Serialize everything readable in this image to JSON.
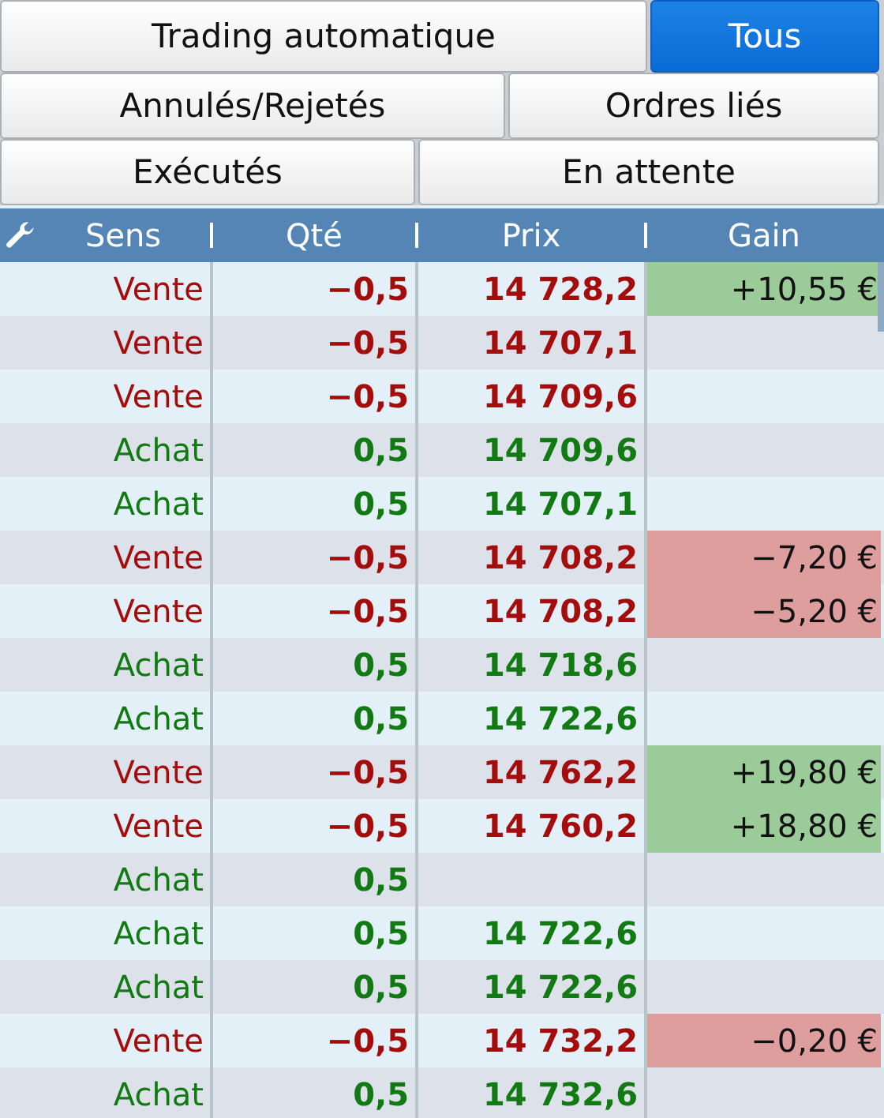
{
  "tab_rows": [
    [
      {
        "label": "Trading automatique",
        "selected": false
      },
      {
        "label": "Tous",
        "selected": true
      }
    ],
    [
      {
        "label": "Annulés/Rejetés",
        "selected": false
      },
      {
        "label": "Ordres liés",
        "selected": false
      }
    ],
    [
      {
        "label": "Exécutés",
        "selected": false
      },
      {
        "label": "En attente",
        "selected": false
      }
    ]
  ],
  "table": {
    "columns": [
      "Sens",
      "Qté",
      "Prix",
      "Gain"
    ],
    "rows": [
      {
        "kind": "sell",
        "sens": "Vente",
        "qty": "−0,5",
        "price": "14 728,2",
        "gain": {
          "text": "+10,55 €",
          "kind": "profit"
        }
      },
      {
        "kind": "sell",
        "sens": "Vente",
        "qty": "−0,5",
        "price": "14 707,1"
      },
      {
        "kind": "sell",
        "sens": "Vente",
        "qty": "−0,5",
        "price": "14 709,6"
      },
      {
        "kind": "buy",
        "sens": "Achat",
        "qty": "0,5",
        "price": "14 709,6"
      },
      {
        "kind": "buy",
        "sens": "Achat",
        "qty": "0,5",
        "price": "14 707,1"
      },
      {
        "kind": "sell",
        "sens": "Vente",
        "qty": "−0,5",
        "price": "14 708,2",
        "gain": {
          "text": "−7,20 €",
          "kind": "loss"
        }
      },
      {
        "kind": "sell",
        "sens": "Vente",
        "qty": "−0,5",
        "price": "14 708,2",
        "gain": {
          "text": "−5,20 €",
          "kind": "loss"
        }
      },
      {
        "kind": "buy",
        "sens": "Achat",
        "qty": "0,5",
        "price": "14 718,6"
      },
      {
        "kind": "buy",
        "sens": "Achat",
        "qty": "0,5",
        "price": "14 722,6"
      },
      {
        "kind": "sell",
        "sens": "Vente",
        "qty": "−0,5",
        "price": "14 762,2",
        "gain": {
          "text": "+19,80 €",
          "kind": "profit"
        }
      },
      {
        "kind": "sell",
        "sens": "Vente",
        "qty": "−0,5",
        "price": "14 760,2",
        "gain": {
          "text": "+18,80 €",
          "kind": "profit"
        }
      },
      {
        "kind": "buy",
        "sens": "Achat",
        "qty": "0,5"
      },
      {
        "kind": "buy",
        "sens": "Achat",
        "qty": "0,5",
        "price": "14 722,6"
      },
      {
        "kind": "buy",
        "sens": "Achat",
        "qty": "0,5",
        "price": "14 722,6"
      },
      {
        "kind": "sell",
        "sens": "Vente",
        "qty": "−0,5",
        "price": "14 732,2",
        "gain": {
          "text": "−0,20 €",
          "kind": "loss"
        }
      },
      {
        "kind": "buy",
        "sens": "Achat",
        "qty": "0,5",
        "price": "14 732,6"
      }
    ]
  }
}
